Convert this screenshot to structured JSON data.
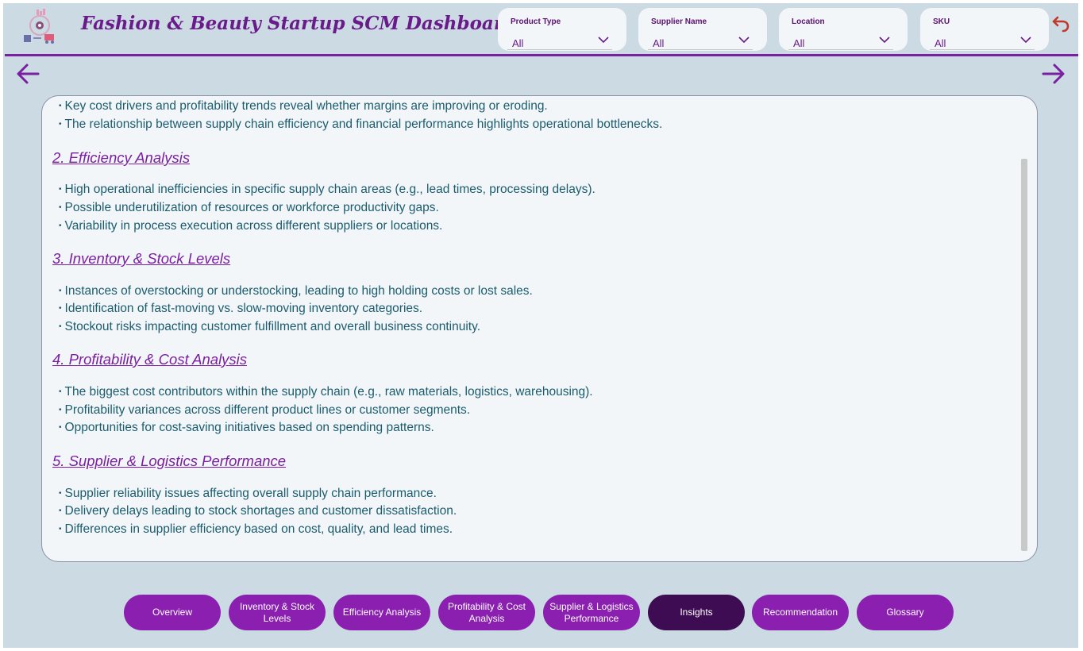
{
  "header": {
    "title": "Fashion & Beauty Startup SCM Dashboard"
  },
  "filters": [
    {
      "label": "Product Type",
      "value": "All"
    },
    {
      "label": "Supplier Name",
      "value": "All"
    },
    {
      "label": "Location",
      "value": "All"
    },
    {
      "label": "SKU",
      "value": "All"
    }
  ],
  "content": {
    "intro_bullets": [
      "Key cost drivers and profitability trends reveal whether margins are improving or eroding.",
      "The relationship between supply chain efficiency and financial performance highlights operational bottlenecks."
    ],
    "sections": [
      {
        "heading": "2. Efficiency Analysis",
        "bullets": [
          "High operational inefficiencies in specific supply chain areas (e.g., lead times, processing delays).",
          "Possible underutilization of resources or workforce productivity gaps.",
          "Variability in process execution across different suppliers or locations."
        ]
      },
      {
        "heading": "3. Inventory & Stock Levels",
        "bullets": [
          "Instances of overstocking or understocking, leading to high holding costs or lost sales.",
          "Identification of fast-moving vs. slow-moving inventory categories.",
          "Stockout risks impacting customer fulfillment and overall business continuity."
        ]
      },
      {
        "heading": "4. Profitability & Cost Analysis",
        "bullets": [
          "The biggest cost contributors within the supply chain (e.g., raw materials, logistics, warehousing).",
          "Profitability variances across different product lines or customer segments.",
          "Opportunities for cost-saving initiatives based on spending patterns."
        ]
      },
      {
        "heading": "5. Supplier & Logistics Performance",
        "bullets": [
          "Supplier reliability issues affecting overall supply chain performance.",
          "Delivery delays leading to stock shortages and customer dissatisfaction.",
          "Differences in supplier efficiency based on cost, quality, and lead times."
        ]
      }
    ]
  },
  "nav_buttons": [
    {
      "label": "Overview",
      "active": false
    },
    {
      "label": "Inventory & Stock Levels",
      "active": false
    },
    {
      "label": "Efficiency Analysis",
      "active": false
    },
    {
      "label": "Profitability & Cost Analysis",
      "active": false
    },
    {
      "label": "Supplier & Logistics Performance",
      "active": false
    },
    {
      "label": "Insights",
      "active": true
    },
    {
      "label": "Recommendation",
      "active": false
    },
    {
      "label": "Glossary",
      "active": false
    }
  ],
  "colors": {
    "accent": "#7b1fa2",
    "background": "#cbdae3",
    "panel": "#f3f6f8",
    "body_text": "#1a5c6e",
    "button": "#8a1fb0",
    "button_active": "#3d0c52",
    "undo": "#c0392b"
  },
  "icons": {
    "logo": "supply-chain-logo-icon",
    "undo": "undo-arrow-icon",
    "back": "arrow-left-icon",
    "forward": "arrow-right-icon",
    "dropdown": "chevron-down-icon"
  }
}
